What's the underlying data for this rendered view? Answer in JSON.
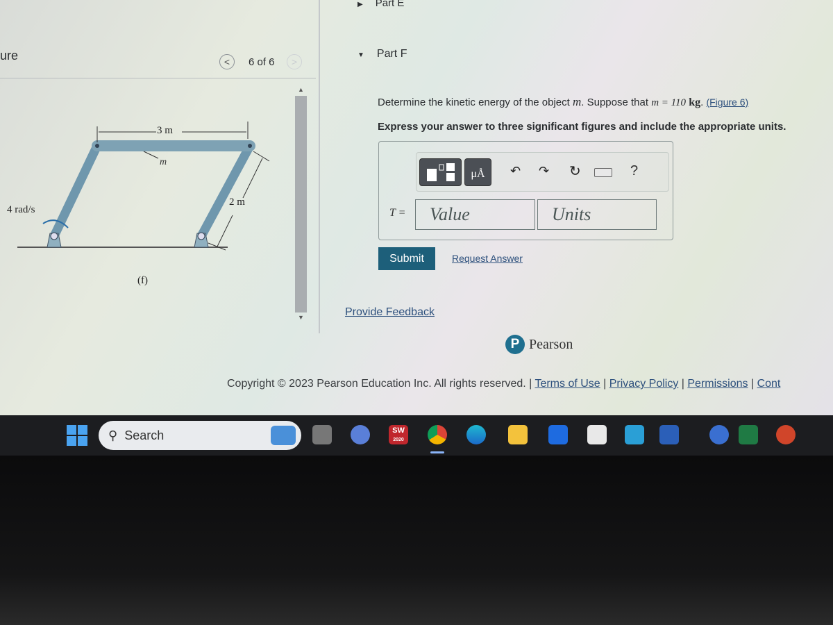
{
  "figure_panel": {
    "title": "ure",
    "nav_label": "6 of 6",
    "prev_icon": "chevron-left-icon",
    "next_icon": "chevron-right-icon",
    "caption": "(f)",
    "labels": {
      "top_length": "3 m",
      "mass": "m",
      "link_length": "2 m",
      "angular_velocity": "4 rad/s"
    }
  },
  "question": {
    "part_e": "Part E",
    "part_f": "Part F",
    "prompt_pre": "Determine the kinetic energy of the object",
    "prompt_var": "m",
    "prompt_mid": ". Suppose that",
    "prompt_eq": "m = 110",
    "prompt_unit": "kg",
    "prompt_dot": ".",
    "figure_link": "(Figure 6)",
    "instruction": "Express your answer to three significant figures and include the appropriate units.",
    "toolbar": [
      "templates-icon",
      "units-icon",
      "undo-icon",
      "redo-icon",
      "reset-icon",
      "keyboard-icon",
      "help-icon"
    ],
    "units_button": "μÅ",
    "help": "?",
    "answer_label": "T =",
    "value_placeholder": "Value",
    "units_placeholder": "Units",
    "submit": "Submit",
    "request_answer": "Request Answer",
    "provide_feedback": "Provide Feedback"
  },
  "footer": {
    "brand": "Pearson",
    "copyright": "Copyright © 2023 Pearson Education Inc. All rights reserved.",
    "links": [
      "Terms of Use",
      "Privacy Policy",
      "Permissions",
      "Cont"
    ]
  },
  "taskbar": {
    "search_label": "Search",
    "apps": [
      "widgets",
      "task-view",
      "meet",
      "solidworks",
      "chrome",
      "edge",
      "file-explorer",
      "dropbox",
      "store",
      "mail",
      "word",
      "copilot",
      "excel",
      "powerpoint"
    ],
    "solidworks_text": "SW",
    "solidworks_year": "2020"
  },
  "colors": {
    "submit": "#1d5f7a",
    "link": "#2c4f7c",
    "taskbar": "#1c1d20"
  }
}
